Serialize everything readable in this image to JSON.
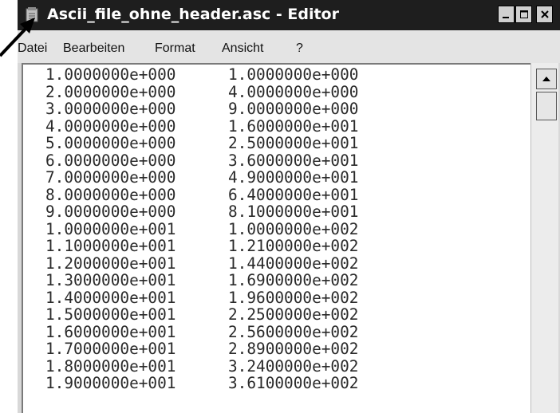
{
  "window": {
    "title": "Ascii_file_ohne_header.asc - Editor",
    "icon": "notepad-icon",
    "controls": [
      "minimize-icon",
      "maximize-icon",
      "close-icon"
    ]
  },
  "menu": [
    "Datei",
    "Bearbeiten",
    "Format",
    "Ansicht",
    "?"
  ],
  "rows": [
    [
      "1.0000000e+000",
      "1.0000000e+000"
    ],
    [
      "2.0000000e+000",
      "4.0000000e+000"
    ],
    [
      "3.0000000e+000",
      "9.0000000e+000"
    ],
    [
      "4.0000000e+000",
      "1.6000000e+001"
    ],
    [
      "5.0000000e+000",
      "2.5000000e+001"
    ],
    [
      "6.0000000e+000",
      "3.6000000e+001"
    ],
    [
      "7.0000000e+000",
      "4.9000000e+001"
    ],
    [
      "8.0000000e+000",
      "6.4000000e+001"
    ],
    [
      "9.0000000e+000",
      "8.1000000e+001"
    ],
    [
      "1.0000000e+001",
      "1.0000000e+002"
    ],
    [
      "1.1000000e+001",
      "1.2100000e+002"
    ],
    [
      "1.2000000e+001",
      "1.4400000e+002"
    ],
    [
      "1.3000000e+001",
      "1.6900000e+002"
    ],
    [
      "1.4000000e+001",
      "1.9600000e+002"
    ],
    [
      "1.5000000e+001",
      "2.2500000e+002"
    ],
    [
      "1.6000000e+001",
      "2.5600000e+002"
    ],
    [
      "1.7000000e+001",
      "2.8900000e+002"
    ],
    [
      "1.8000000e+001",
      "3.2400000e+002"
    ],
    [
      "1.9000000e+001",
      "3.6100000e+002"
    ]
  ],
  "scrollbar": {
    "up_icon": "arrow-up-icon"
  },
  "annotation": {
    "icon": "arrow-pointer-icon"
  }
}
